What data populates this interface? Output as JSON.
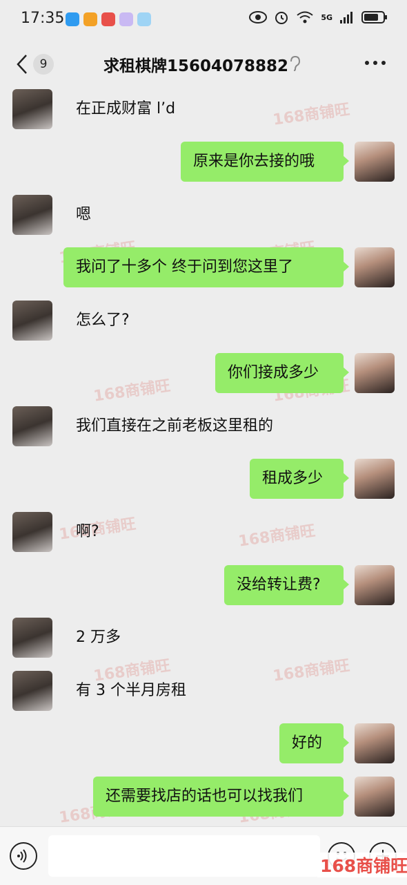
{
  "status_bar": {
    "time": "17:35",
    "network": "5G"
  },
  "header": {
    "back_count": "9",
    "title": "求租棋牌15604078882",
    "ear_icon": "ear-icon",
    "more_icon": "more-dots-icon"
  },
  "messages": [
    {
      "side": "them",
      "text": "在正成财富 l’d"
    },
    {
      "side": "me",
      "text": "原来是你去接的哦"
    },
    {
      "side": "them",
      "text": "嗯"
    },
    {
      "side": "me",
      "text": "我问了十多个 终于问到您这里了"
    },
    {
      "side": "them",
      "text": "怎么了?"
    },
    {
      "side": "me",
      "text": "你们接成多少"
    },
    {
      "side": "them",
      "text": "我们直接在之前老板这里租的"
    },
    {
      "side": "me",
      "text": "租成多少"
    },
    {
      "side": "them",
      "text": "啊?"
    },
    {
      "side": "me",
      "text": "没给转让费?"
    },
    {
      "side": "them",
      "text": "2 万多"
    },
    {
      "side": "them",
      "text": "有 3 个半月房租"
    },
    {
      "side": "me",
      "text": "好的"
    },
    {
      "side": "me",
      "text": "还需要找店的话也可以找我们"
    }
  ],
  "watermark": "168商铺旺",
  "input": {
    "placeholder": "",
    "voice_icon": "voice-icon",
    "emoji_icon": "emoji-icon",
    "plus_icon": "plus-icon"
  },
  "brand_logo": "168商铺旺",
  "colors": {
    "bubble_me": "#95ec69",
    "background": "#ededed",
    "watermark": "#e8504a"
  }
}
